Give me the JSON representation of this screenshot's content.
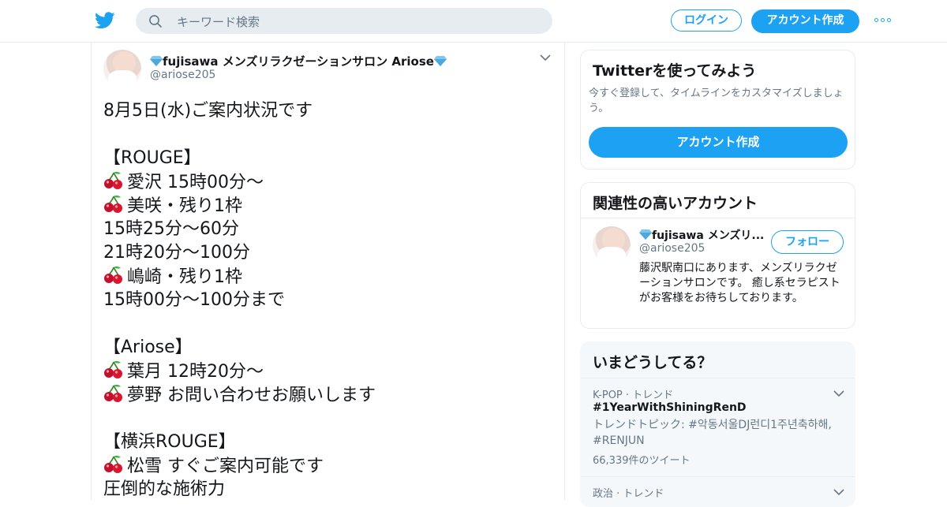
{
  "header": {
    "search_placeholder": "キーワード検索",
    "login_label": "ログイン",
    "signup_label": "アカウント作成"
  },
  "tweet": {
    "author_name": "fujisawa メンズリラクゼーションサロン Ariose",
    "author_handle": "@ariose205",
    "lines": [
      {
        "emoji": false,
        "text": "8月5日(水)ご案内状況です"
      },
      {
        "emoji": false,
        "text": ""
      },
      {
        "emoji": false,
        "text": "【ROUGE】"
      },
      {
        "emoji": true,
        "text": "愛沢 15時00分～"
      },
      {
        "emoji": true,
        "text": "美咲・残り1枠"
      },
      {
        "emoji": false,
        "text": "15時25分～60分"
      },
      {
        "emoji": false,
        "text": "21時20分～100分"
      },
      {
        "emoji": true,
        "text": "嶋崎・残り1枠"
      },
      {
        "emoji": false,
        "text": "15時00分～100分まで"
      },
      {
        "emoji": false,
        "text": ""
      },
      {
        "emoji": false,
        "text": "【Ariose】"
      },
      {
        "emoji": true,
        "text": "葉月 12時20分～"
      },
      {
        "emoji": true,
        "text": "夢野 お問い合わせお願いします"
      },
      {
        "emoji": false,
        "text": ""
      },
      {
        "emoji": false,
        "text": "【横浜ROUGE】"
      },
      {
        "emoji": true,
        "text": "松雪 すぐご案内可能です"
      },
      {
        "emoji": false,
        "text": "圧倒的な施術力"
      }
    ]
  },
  "signup_card": {
    "title": "Twitterを使ってみよう",
    "description": "今すぐ登録して、タイムラインをカスタマイズしましょう。",
    "button_label": "アカウント作成"
  },
  "related": {
    "title": "関連性の高いアカウント",
    "name": "fujisawa メンズリ...",
    "handle": "@ariose205",
    "follow_label": "フォロー",
    "bio": "藤沢駅南口にあります、メンズリラクゼーションサロンです。 癒し系セラピストがお客様をお待ちしております。"
  },
  "trends": {
    "title": "いまどうしてる？",
    "items": [
      {
        "meta": "K-POP · トレンド",
        "name": "#1YearWithShiningRenD",
        "desc": "トレンドトピック: #악동서울DJ런디1주년축하해, #RENJUN",
        "count": "66,339件のツイート"
      },
      {
        "meta": "政治 · トレンド"
      }
    ]
  },
  "colors": {
    "accent": "#1da1f2",
    "text": "#14171a",
    "muted": "#657786",
    "border": "#e6ecf0"
  }
}
